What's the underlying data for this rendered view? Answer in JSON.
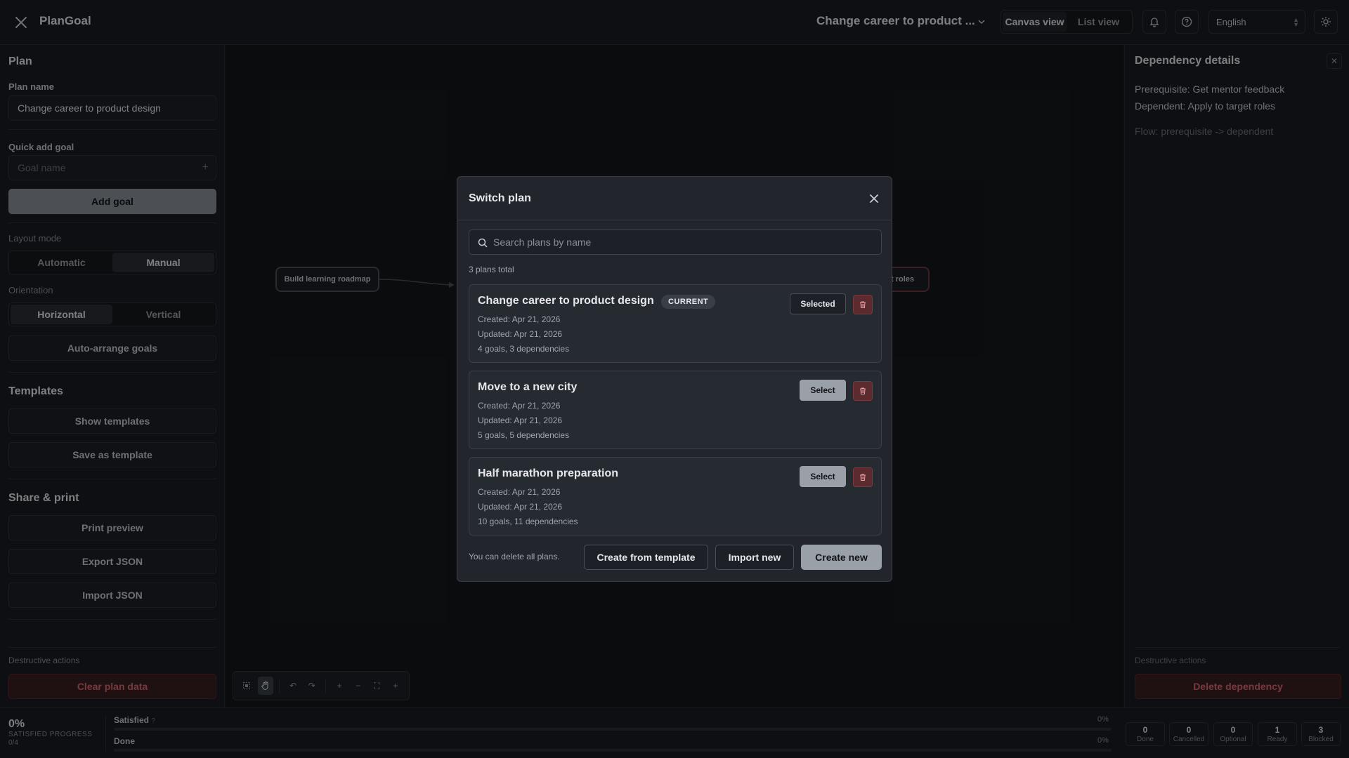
{
  "header": {
    "brand": "PlanGoal",
    "plan_title": "Change career to product ...",
    "view_canvas": "Canvas view",
    "view_list": "List view",
    "language": "English"
  },
  "sidebar": {
    "plan_heading": "Plan",
    "plan_name_label": "Plan name",
    "plan_name_value": "Change career to product design",
    "quick_add_label": "Quick add goal",
    "goal_name_placeholder": "Goal name",
    "add_goal": "Add goal",
    "layout_mode_label": "Layout mode",
    "layout_automatic": "Automatic",
    "layout_manual": "Manual",
    "orientation_label": "Orientation",
    "orientation_horizontal": "Horizontal",
    "orientation_vertical": "Vertical",
    "auto_arrange": "Auto-arrange goals",
    "templates_heading": "Templates",
    "show_templates": "Show templates",
    "save_as_template": "Save as template",
    "share_heading": "Share & print",
    "print_preview": "Print preview",
    "export_json": "Export JSON",
    "import_json": "Import JSON",
    "destructive_label": "Destructive actions",
    "clear_plan_data": "Clear plan data"
  },
  "canvas": {
    "node_left": "Build learning roadmap",
    "node_right_partial": "t roles"
  },
  "right_panel": {
    "title": "Dependency details",
    "prerequisite": "Prerequisite: Get mentor feedback",
    "dependent": "Dependent: Apply to target roles",
    "flow": "Flow: prerequisite -> dependent",
    "destructive_label": "Destructive actions",
    "delete_dependency": "Delete dependency"
  },
  "status": {
    "percent": "0%",
    "percent_label": "SATISFIED PROGRESS",
    "count": "0/4",
    "satisfied_label": "Satisfied",
    "satisfied_help": "?",
    "satisfied_pct": "0%",
    "satisfied_fraction": 0,
    "done_label": "Done",
    "done_pct": "0%",
    "done_fraction": 0,
    "stats": [
      {
        "n": "0",
        "l": "Done"
      },
      {
        "n": "0",
        "l": "Cancelled"
      },
      {
        "n": "0",
        "l": "Optional"
      },
      {
        "n": "1",
        "l": "Ready"
      },
      {
        "n": "3",
        "l": "Blocked"
      }
    ]
  },
  "modal": {
    "title": "Switch plan",
    "search_placeholder": "Search plans by name",
    "total": "3 plans total",
    "plans": [
      {
        "name": "Change career to product design",
        "badge": "CURRENT",
        "created": "Created: Apr 21, 2026",
        "updated": "Updated: Apr 21, 2026",
        "stats": "4 goals, 3 dependencies",
        "action": "Selected"
      },
      {
        "name": "Move to a new city",
        "created": "Created: Apr 21, 2026",
        "updated": "Updated: Apr 21, 2026",
        "stats": "5 goals, 5 dependencies",
        "action": "Select"
      },
      {
        "name": "Half marathon preparation",
        "created": "Created: Apr 21, 2026",
        "updated": "Updated: Apr 21, 2026",
        "stats": "10 goals, 11 dependencies",
        "action": "Select"
      }
    ],
    "footnote": "You can delete all plans.",
    "create_from_template": "Create from template",
    "import_new": "Import new",
    "create_new": "Create new"
  }
}
